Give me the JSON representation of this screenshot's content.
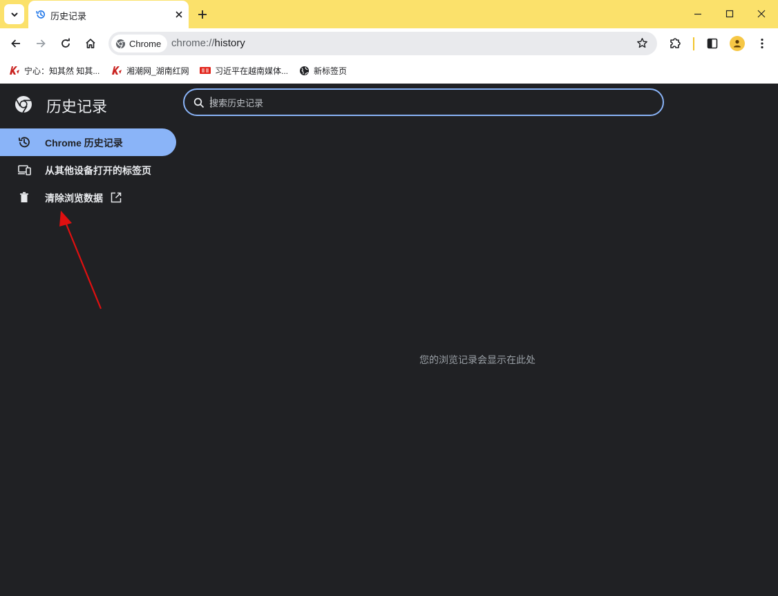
{
  "tab": {
    "title": "历史记录"
  },
  "toolbar": {
    "site_chip": "Chrome",
    "url_scheme": "chrome://",
    "url_host": "history"
  },
  "bookmarks": [
    {
      "label": "宁心：知其然 知其...",
      "icon": "kuaikan-icon"
    },
    {
      "label": "湘潮网_湖南红网",
      "icon": "kuaikan-icon"
    },
    {
      "label": "习近平在越南媒体...",
      "icon": "toutiao-icon"
    },
    {
      "label": "新标签页",
      "icon": "globe-icon"
    }
  ],
  "page": {
    "title": "历史记录",
    "search_placeholder": "搜索历史记录",
    "nav": [
      {
        "label": "Chrome 历史记录",
        "icon": "history-icon",
        "selected": true
      },
      {
        "label": "从其他设备打开的标签页",
        "icon": "devices-icon"
      },
      {
        "label": "清除浏览数据",
        "icon": "trash-icon"
      }
    ],
    "empty_message": "您的浏览记录会显示在此处"
  },
  "colors": {
    "tabstrip": "#fbe16b",
    "page_bg": "#202124",
    "accent": "#8ab4f8",
    "annotation_arrow": "#e01010"
  }
}
